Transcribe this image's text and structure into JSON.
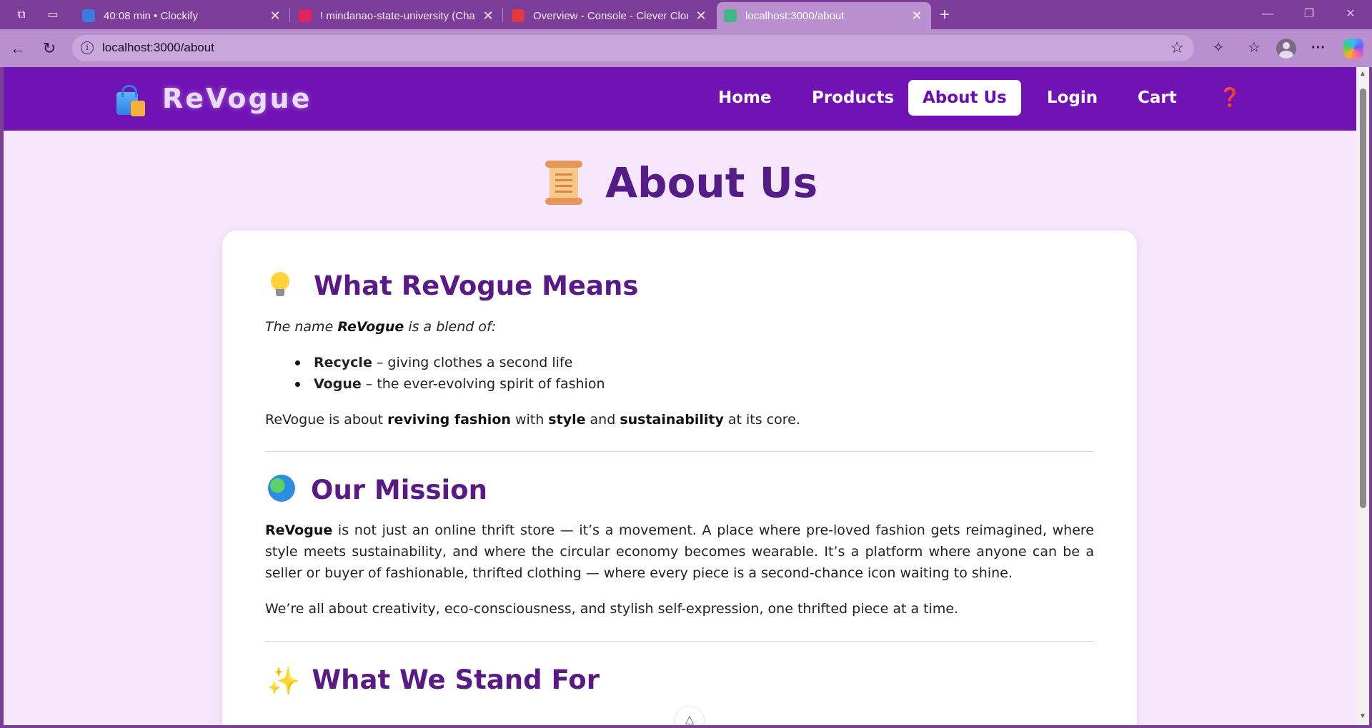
{
  "browser": {
    "tabs": [
      {
        "title": "40:08 min • Clockify",
        "favicon_color": "#3a7be0"
      },
      {
        "title": "! mindanao-state-university (Char",
        "favicon_color": "#e0245e"
      },
      {
        "title": "Overview - Console - Clever Clouc",
        "favicon_color": "#e03b3b"
      },
      {
        "title": "localhost:3000/about",
        "favicon_color": "#41b883"
      }
    ],
    "url": "localhost:3000/about",
    "icons": {
      "workspaces": "workspaces-icon",
      "tab_actions": "tab-actions-icon",
      "new_tab": "+",
      "back": "back-arrow-icon",
      "refresh": "refresh-icon",
      "favorite": "star-icon",
      "extensions": "puzzle-icon",
      "favorites": "favorites-icon",
      "profile": "profile-icon",
      "more": "···",
      "copilot": "copilot-icon"
    }
  },
  "site": {
    "brand": "ReVogue",
    "nav": [
      {
        "label": "Home"
      },
      {
        "label": "Products"
      },
      {
        "label": "About Us",
        "active": true
      },
      {
        "label": "Login"
      },
      {
        "label": "Cart"
      }
    ],
    "help_label": "❓",
    "accent_color": "#7012b4",
    "page_bg": "#f5e6fc"
  },
  "page": {
    "title": "About Us",
    "sections": {
      "means": {
        "heading": "What ReVogue Means",
        "intro_pre": "The name ",
        "intro_bold": "ReVogue",
        "intro_post": " is a blend of:",
        "bullets": [
          {
            "term": "Recycle",
            "desc": " – giving clothes a second life"
          },
          {
            "term": "Vogue",
            "desc": " – the ever-evolving spirit of fashion"
          }
        ],
        "summary": {
          "p1": "ReVogue is about ",
          "b1": "reviving fashion",
          "p2": " with ",
          "b2": "style",
          "p3": " and ",
          "b3": "sustainability",
          "p4": " at its core."
        }
      },
      "mission": {
        "heading": "Our Mission",
        "lead_bold": "ReVogue",
        "body": " is not just an online thrift store — it’s a movement. A place where pre-loved fashion gets reimagined, where style meets sustainability, and where the circular economy becomes wearable. It’s a platform where anyone can be a seller or buyer of fashionable, thrifted clothing — where every piece is a second-chance icon waiting to shine.",
        "closing": "We’re all about creativity, eco-consciousness, and stylish self-expression, one thrifted piece at a time."
      },
      "stand": {
        "heading": "What We Stand For"
      }
    }
  }
}
